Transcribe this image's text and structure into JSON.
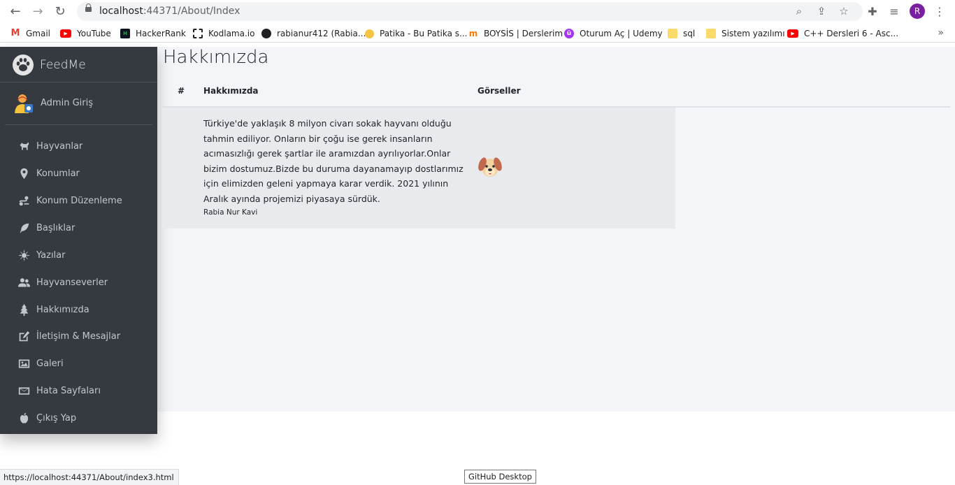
{
  "browser": {
    "url_host": "localhost",
    "url_path": ":44371/About/Index",
    "profile_initial": "R",
    "bookmarks": [
      {
        "label": "Gmail",
        "icon": "gmail-icon",
        "color": "#ea4335"
      },
      {
        "label": "YouTube",
        "icon": "youtube-icon",
        "color": "#ff0000"
      },
      {
        "label": "HackerRank",
        "icon": "hackerrank-icon",
        "color": "#1ba94c"
      },
      {
        "label": "Kodlama.io",
        "icon": "kodlama-icon",
        "color": "#202124"
      },
      {
        "label": "rabianur412 (Rabia...",
        "icon": "github-icon",
        "color": "#202124"
      },
      {
        "label": "Patika - Bu Patika s...",
        "icon": "patika-icon",
        "color": "#f6c445"
      },
      {
        "label": "BOYSİS | Derslerim",
        "icon": "boysis-icon",
        "color": "#f57c00"
      },
      {
        "label": "Oturum Aç | Udemy",
        "icon": "udemy-icon",
        "color": "#a435f0"
      },
      {
        "label": "sql",
        "icon": "folder-icon",
        "color": "#fcd96b"
      },
      {
        "label": "Sistem yazılımı",
        "icon": "folder-icon",
        "color": "#fcd96b"
      },
      {
        "label": "C++ Dersleri 6 - Asc...",
        "icon": "youtube-icon",
        "color": "#ff0000"
      }
    ],
    "status_url": "https://localhost:44371/About/index3.html",
    "tooltip": "GitHub Desktop"
  },
  "sidebar": {
    "brand": "FeedMe",
    "user": "Admin Giriş",
    "items": [
      {
        "label": "Hayvanlar",
        "icon": "horse-icon"
      },
      {
        "label": "Konumlar",
        "icon": "map-marker-icon"
      },
      {
        "label": "Konum Düzenleme",
        "icon": "route-icon"
      },
      {
        "label": "Başlıklar",
        "icon": "feather-icon"
      },
      {
        "label": "Yazılar",
        "icon": "sun-icon"
      },
      {
        "label": "Hayvanseverler",
        "icon": "users-icon"
      },
      {
        "label": "Hakkımızda",
        "icon": "tree-icon"
      },
      {
        "label": "İletişim & Mesajlar",
        "icon": "edit-icon"
      },
      {
        "label": "Galeri",
        "icon": "image-icon"
      },
      {
        "label": "Hata Sayfaları",
        "icon": "envelope-icon"
      },
      {
        "label": "Çıkış Yap",
        "icon": "apple-icon"
      }
    ]
  },
  "main": {
    "title": "Hakkımızda",
    "columns": [
      "#",
      "Hakkımızda",
      "Görseller"
    ],
    "rows": [
      {
        "number": "",
        "text": "Türkiye'de yaklaşık 8 milyon civarı sokak hayvanı olduğu tahmin ediliyor. Onların bir çoğu ise gerek insanların acımasızlığı gerek şartlar ile aramızdan ayrılıyorlar.Onlar bizim dostumuz.Bizde bu duruma dayanamayıp dostlarımız için elimizden geleni yapmaya karar verdik. 2021 yılının Aralık ayında projemizi piyasaya sürdük.",
        "author": "Rabia Nur Kavi",
        "image": "dog-face-icon"
      }
    ]
  },
  "colors": {
    "sidebar_bg": "#343a40",
    "sidebar_text": "#c2c7d0",
    "page_bg": "#f4f5f8",
    "row_bg": "#e9eaed"
  }
}
